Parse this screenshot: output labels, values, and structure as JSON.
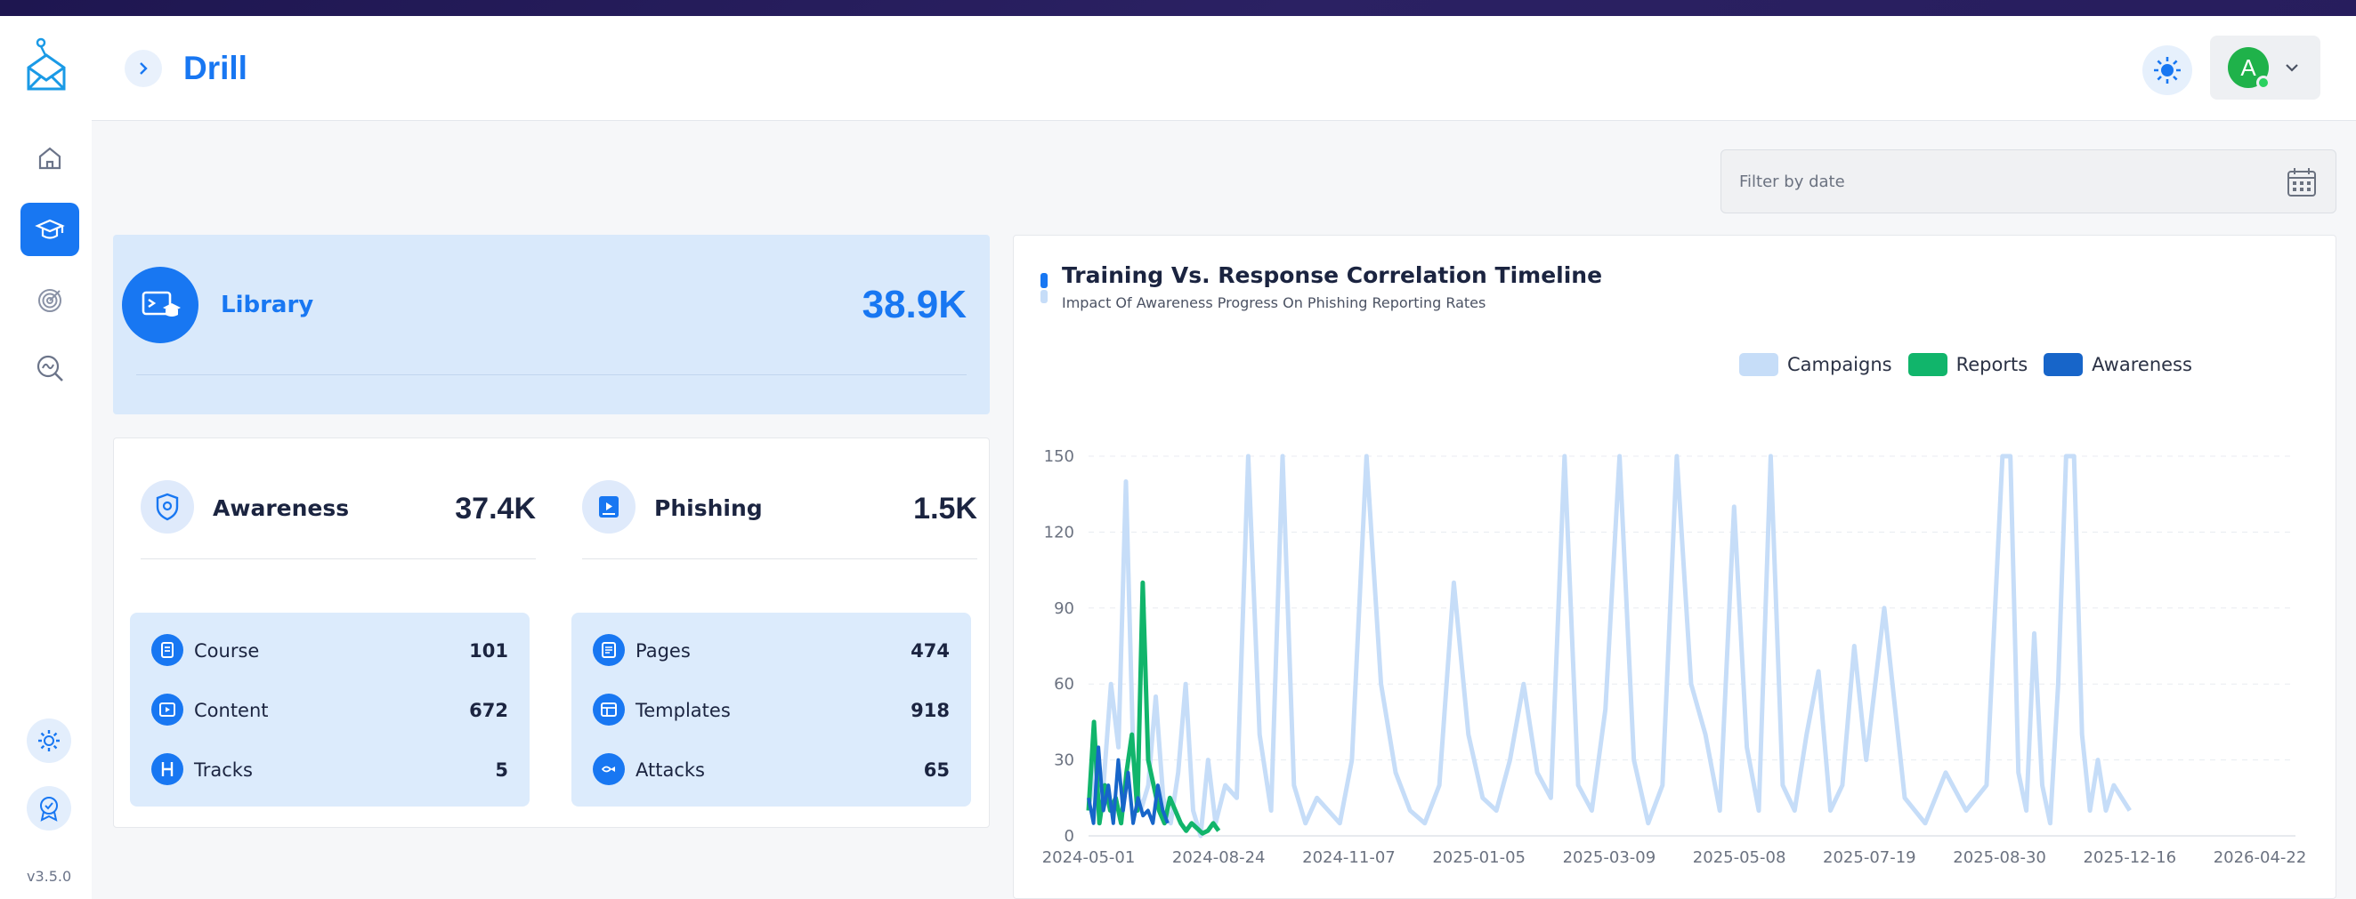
{
  "app": {
    "title": "Drill",
    "version": "v3.5.0"
  },
  "sidebar": {
    "items": [
      {
        "name": "home",
        "icon": "home-icon",
        "active": false
      },
      {
        "name": "training",
        "icon": "graduation-cap-icon",
        "active": true
      },
      {
        "name": "campaigns",
        "icon": "target-icon",
        "active": false
      },
      {
        "name": "search",
        "icon": "search-analytics-icon",
        "active": false
      }
    ],
    "bottom": [
      {
        "name": "settings",
        "icon": "gear-icon"
      },
      {
        "name": "certificate",
        "icon": "award-badge-icon"
      }
    ]
  },
  "header": {
    "user_initial": "A"
  },
  "filter": {
    "placeholder": "Filter by date"
  },
  "library": {
    "label": "Library",
    "value": "38.9K"
  },
  "awareness": {
    "label": "Awareness",
    "value": "37.4K",
    "items": [
      {
        "label": "Course",
        "value": "101"
      },
      {
        "label": "Content",
        "value": "672"
      },
      {
        "label": "Tracks",
        "value": "5"
      }
    ]
  },
  "phishing": {
    "label": "Phishing",
    "value": "1.5K",
    "items": [
      {
        "label": "Pages",
        "value": "474"
      },
      {
        "label": "Templates",
        "value": "918"
      },
      {
        "label": "Attacks",
        "value": "65"
      }
    ]
  },
  "colors": {
    "primary": "#1877f2",
    "campaigns": "#c6ddf8",
    "reports": "#11b56b",
    "awareness": "#1765c9"
  },
  "chart_data": {
    "type": "line",
    "title": "Training Vs. Response Correlation Timeline",
    "subtitle": "Impact Of Awareness Progress On Phishing Reporting Rates",
    "xlabel": "",
    "ylabel": "",
    "ylim": [
      0,
      150
    ],
    "yticks": [
      0,
      30,
      60,
      90,
      120,
      150
    ],
    "x_ticks": [
      "2024-05-01",
      "2024-08-24",
      "2024-11-07",
      "2025-01-05",
      "2025-03-09",
      "2025-05-08",
      "2025-07-19",
      "2025-08-30",
      "2025-12-16",
      "2026-04-22"
    ],
    "grid": true,
    "legend_position": "top-right",
    "series": [
      {
        "name": "Campaigns",
        "values": [
          10,
          30,
          20,
          60,
          35,
          140,
          30,
          10,
          20,
          55,
          15,
          5,
          25,
          60,
          10,
          0,
          30,
          5,
          20,
          15,
          150,
          40,
          10,
          150,
          20,
          5,
          15,
          10,
          5,
          30,
          150,
          60,
          25,
          10,
          5,
          20,
          100,
          40,
          15,
          10,
          30,
          60,
          25,
          15,
          150,
          20,
          10,
          50,
          150,
          30,
          5,
          20,
          150,
          60,
          40,
          10,
          130,
          35,
          10,
          150,
          20,
          10,
          40,
          65,
          10,
          20,
          75,
          30,
          90,
          15,
          5,
          25,
          10,
          20,
          150,
          150,
          25,
          10,
          80,
          20,
          5,
          60,
          150,
          150,
          40,
          10,
          30,
          10,
          20,
          15,
          10
        ],
        "x_start": "2024-05-01",
        "x_end": "2025-12-16"
      },
      {
        "name": "Reports",
        "values": [
          10,
          45,
          5,
          20,
          10,
          15,
          5,
          25,
          40,
          10,
          100,
          30,
          20,
          10,
          5,
          15,
          10,
          5,
          2,
          5,
          3,
          1,
          2,
          5,
          2
        ],
        "x_start": "2024-05-01",
        "x_end": "2024-08-24"
      },
      {
        "name": "Awareness",
        "values": [
          15,
          5,
          35,
          10,
          20,
          5,
          30,
          10,
          25,
          5,
          15,
          8,
          10,
          5,
          20,
          10,
          5
        ],
        "x_start": "2024-05-01",
        "x_end": "2024-07-10"
      }
    ]
  }
}
